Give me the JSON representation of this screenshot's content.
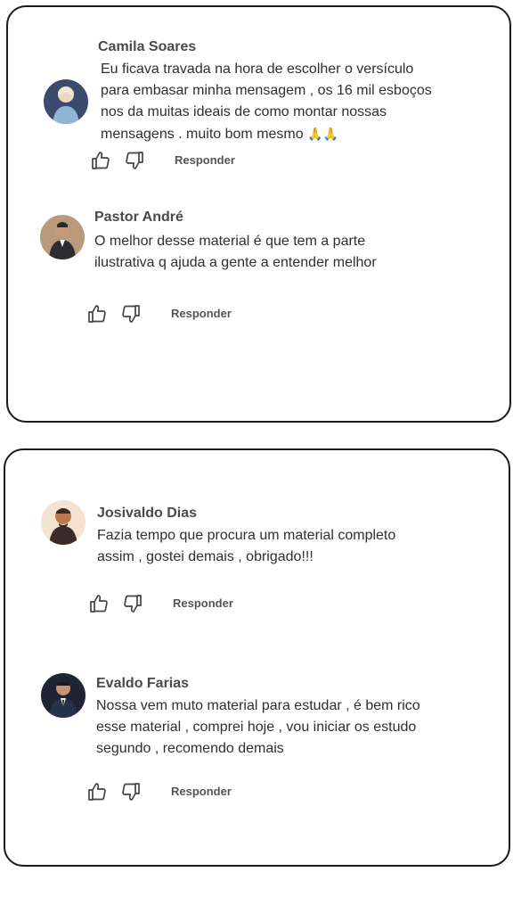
{
  "comments": [
    {
      "author": "Camila Soares",
      "text": "Eu ficava travada na hora de escolher o versículo\npara embasar minha mensagem , os 16 mil esboços\nnos da muitas ideais de como montar nossas\nmensagens . muito bom mesmo",
      "emoji": "🙏🙏",
      "reply_label": "Responder",
      "avatar_icon": "user-avatar-photo"
    },
    {
      "author": "Pastor André",
      "text": "O melhor desse material é que tem a parte\nilustrativa q ajuda a gente a entender melhor",
      "reply_label": "Responder",
      "avatar_icon": "user-avatar-photo"
    },
    {
      "author": "Josivaldo Dias",
      "text": "Fazia tempo que procura um material completo\nassim , gostei demais , obrigado!!!",
      "reply_label": "Responder",
      "avatar_icon": "user-avatar-photo"
    },
    {
      "author": "Evaldo Farias",
      "text": "Nossa vem muto material para estudar , é bem rico\nesse material , comprei hoje , vou iniciar os estudo\nsegundo , recomendo demais",
      "reply_label": "Responder",
      "avatar_icon": "user-avatar-photo"
    }
  ],
  "icons": {
    "like": "thumbs-up-icon",
    "dislike": "thumbs-down-icon"
  },
  "colors": {
    "card_border": "#1a1a1a",
    "author_text": "#4a4a4a",
    "body_text": "#2f2f2f"
  }
}
